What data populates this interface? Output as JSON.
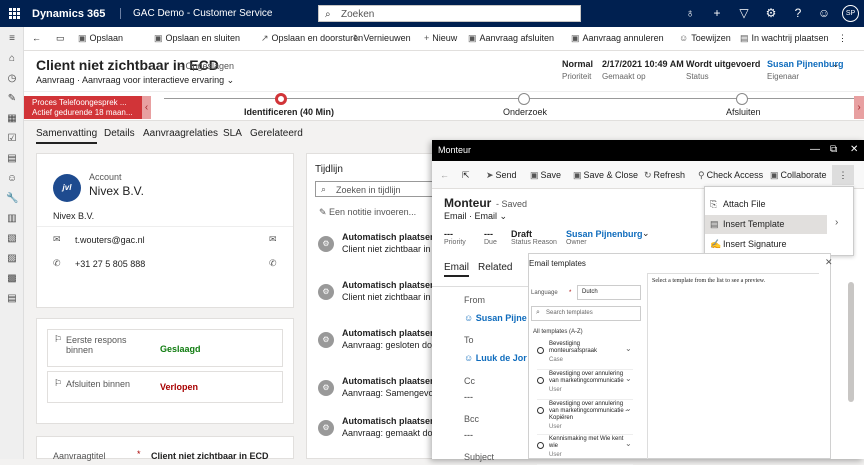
{
  "topbar": {
    "brand": "Dynamics 365",
    "app": "GAC Demo - Customer Service",
    "search_placeholder": "Zoeken",
    "avatar": "SP"
  },
  "commands": [
    "Opslaan",
    "Opslaan en sluiten",
    "Opslaan en doorsturen",
    "Vernieuwen",
    "Nieuw",
    "Aanvraag afsluiten",
    "Aanvraag annuleren",
    "Toewijzen",
    "In wachtrij plaatsen"
  ],
  "header": {
    "title": "Client niet zichtbaar in ECD",
    "saved": "- Opgeslagen",
    "type": "Aanvraag",
    "form": "Aanvraag voor interactieve ervaring",
    "fields": [
      {
        "value": "Normal",
        "label": "Prioriteit"
      },
      {
        "value": "2/17/2021 10:49 AM",
        "label": "Gemaakt op"
      },
      {
        "value": "Wordt uitgevoerd",
        "label": "Status"
      },
      {
        "value": "Susan Pijnenburg",
        "label": "Eigenaar"
      }
    ]
  },
  "bpf": {
    "process": "Proces Telefoongesprek ...",
    "active_for": "Actief gedurende 18 maan...",
    "stages": [
      "Identificeren (40 Min)",
      "Onderzoek",
      "Afsluiten"
    ]
  },
  "tabs": [
    "Samenvatting",
    "Details",
    "Aanvraagrelaties",
    "SLA",
    "Gerelateerd"
  ],
  "account": {
    "label": "Account",
    "name": "Nivex B.V.",
    "logo": "jvl",
    "company": "Nivex B.V.",
    "email": "t.wouters@gac.nl",
    "phone": "+31 27 5 805 888"
  },
  "sla": [
    {
      "label": "Eerste respons binnen",
      "status": "Geslaagd",
      "color": "#107c10"
    },
    {
      "label": "Afsluiten binnen",
      "status": "Verlopen",
      "color": "#a80000"
    }
  ],
  "bottom": {
    "label": "Aanvraagtitel",
    "value": "Client niet zichtbaar in ECD"
  },
  "timeline": {
    "title": "Tijdlijn",
    "search": "Zoeken in tijdlijn",
    "note": "Een notitie invoeren...",
    "items": [
      {
        "title": "Automatisch plaatsen",
        "sub": "Client niet zichtbaar in EC"
      },
      {
        "title": "Automatisch plaatsen",
        "sub": "Client niet zichtbaar in EC"
      },
      {
        "title": "Automatisch plaatsen",
        "sub": "Aanvraag: gesloten door Ni"
      },
      {
        "title": "Automatisch plaatsen",
        "sub": "Aanvraag: Samengevoegd"
      },
      {
        "title": "Automatisch plaatsen",
        "sub": "Aanvraag: gemaakt door"
      }
    ]
  },
  "dialog": {
    "title": "Monteur",
    "commands": [
      "Send",
      "Save",
      "Save & Close",
      "Refresh",
      "Check Access",
      "Collaborate"
    ],
    "heading": "Monteur",
    "saved": "- Saved",
    "type": "Email",
    "form": "Email",
    "fields": [
      {
        "value": "---",
        "label": "Priority"
      },
      {
        "value": "---",
        "label": "Due"
      },
      {
        "value": "Draft",
        "label": "Status Reason"
      },
      {
        "value": "Susan Pijnenburg",
        "label": "Owner"
      }
    ],
    "tabs": [
      "Email",
      "Related"
    ],
    "form_fields": [
      {
        "label": "From",
        "value": "Susan Pijne"
      },
      {
        "label": "To",
        "value": "Luuk de Jor"
      },
      {
        "label": "Cc",
        "value": "---"
      },
      {
        "label": "Bcc",
        "value": "---"
      },
      {
        "label": "Subject",
        "value": ""
      }
    ],
    "menu": [
      "Attach File",
      "Insert Template",
      "Insert Signature"
    ],
    "templates": {
      "title": "Email templates",
      "language_label": "Language",
      "language": "Dutch",
      "search": "Search templates",
      "group": "All templates (A-Z)",
      "preview": "Select a template from the list to see a preview.",
      "items": [
        {
          "name": "Bevestiging monteursafspraak",
          "cat": "Case"
        },
        {
          "name": "Bevestiging over annulering van marketingcommunicatie",
          "cat": "User"
        },
        {
          "name": "Bevestiging over annulering van marketingcommunicatie - Kopiëren",
          "cat": "User"
        },
        {
          "name": "Kennismaking met Wie kent wie",
          "cat": "User"
        }
      ]
    }
  }
}
